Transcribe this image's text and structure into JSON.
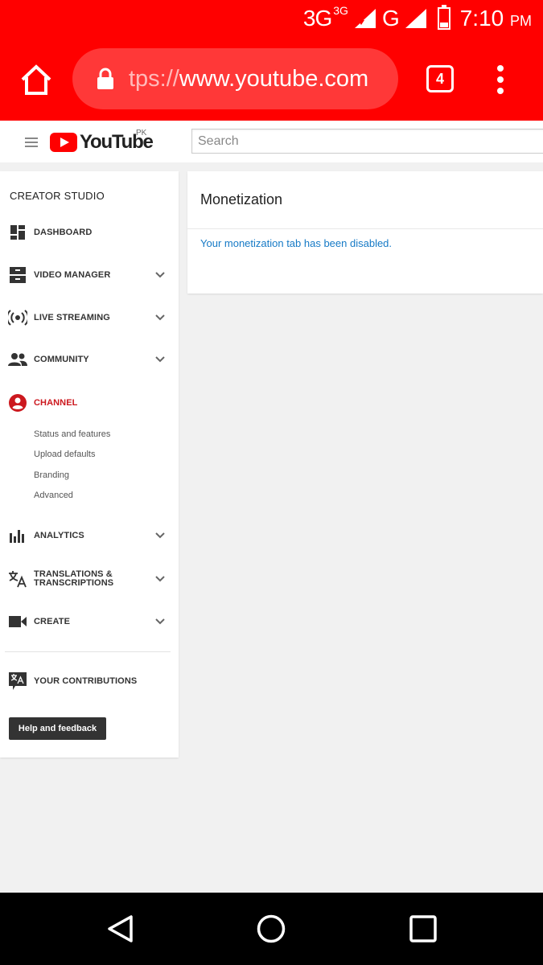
{
  "status_bar": {
    "network_primary": "3G",
    "network_secondary": "3G",
    "network_tertiary": "G",
    "time": "7:10",
    "time_suffix": "PM"
  },
  "browser": {
    "url_dim": "tps://",
    "url_main": "www.youtube.com",
    "tab_count": "4",
    "accent_color": "#ff0000"
  },
  "youtube": {
    "logo_text": "YouTube",
    "country_code": "PK",
    "search_placeholder": "Search"
  },
  "sidebar": {
    "title": "CREATOR STUDIO",
    "items": [
      {
        "label": "DASHBOARD",
        "icon": "dashboard-icon",
        "has_chevron": false
      },
      {
        "label": "VIDEO MANAGER",
        "icon": "video-manager-icon",
        "has_chevron": true
      },
      {
        "label": "LIVE STREAMING",
        "icon": "live-streaming-icon",
        "has_chevron": true
      },
      {
        "label": "COMMUNITY",
        "icon": "community-icon",
        "has_chevron": true
      },
      {
        "label": "CHANNEL",
        "icon": "channel-icon",
        "has_chevron": false,
        "active": true
      },
      {
        "label": "ANALYTICS",
        "icon": "analytics-icon",
        "has_chevron": true
      },
      {
        "label": "TRANSLATIONS & TRANSCRIPTIONS",
        "icon": "translate-icon",
        "has_chevron": true
      },
      {
        "label": "CREATE",
        "icon": "video-camera-icon",
        "has_chevron": true
      },
      {
        "label": "YOUR CONTRIBUTIONS",
        "icon": "contributions-icon",
        "has_chevron": false
      }
    ],
    "channel_subitems": [
      "Status and features",
      "Upload defaults",
      "Branding",
      "Advanced"
    ],
    "help_button": "Help and feedback",
    "active_color": "#cc181e"
  },
  "main": {
    "title": "Monetization",
    "message": "Your monetization tab has been disabled.",
    "message_color": "#167ac6"
  }
}
